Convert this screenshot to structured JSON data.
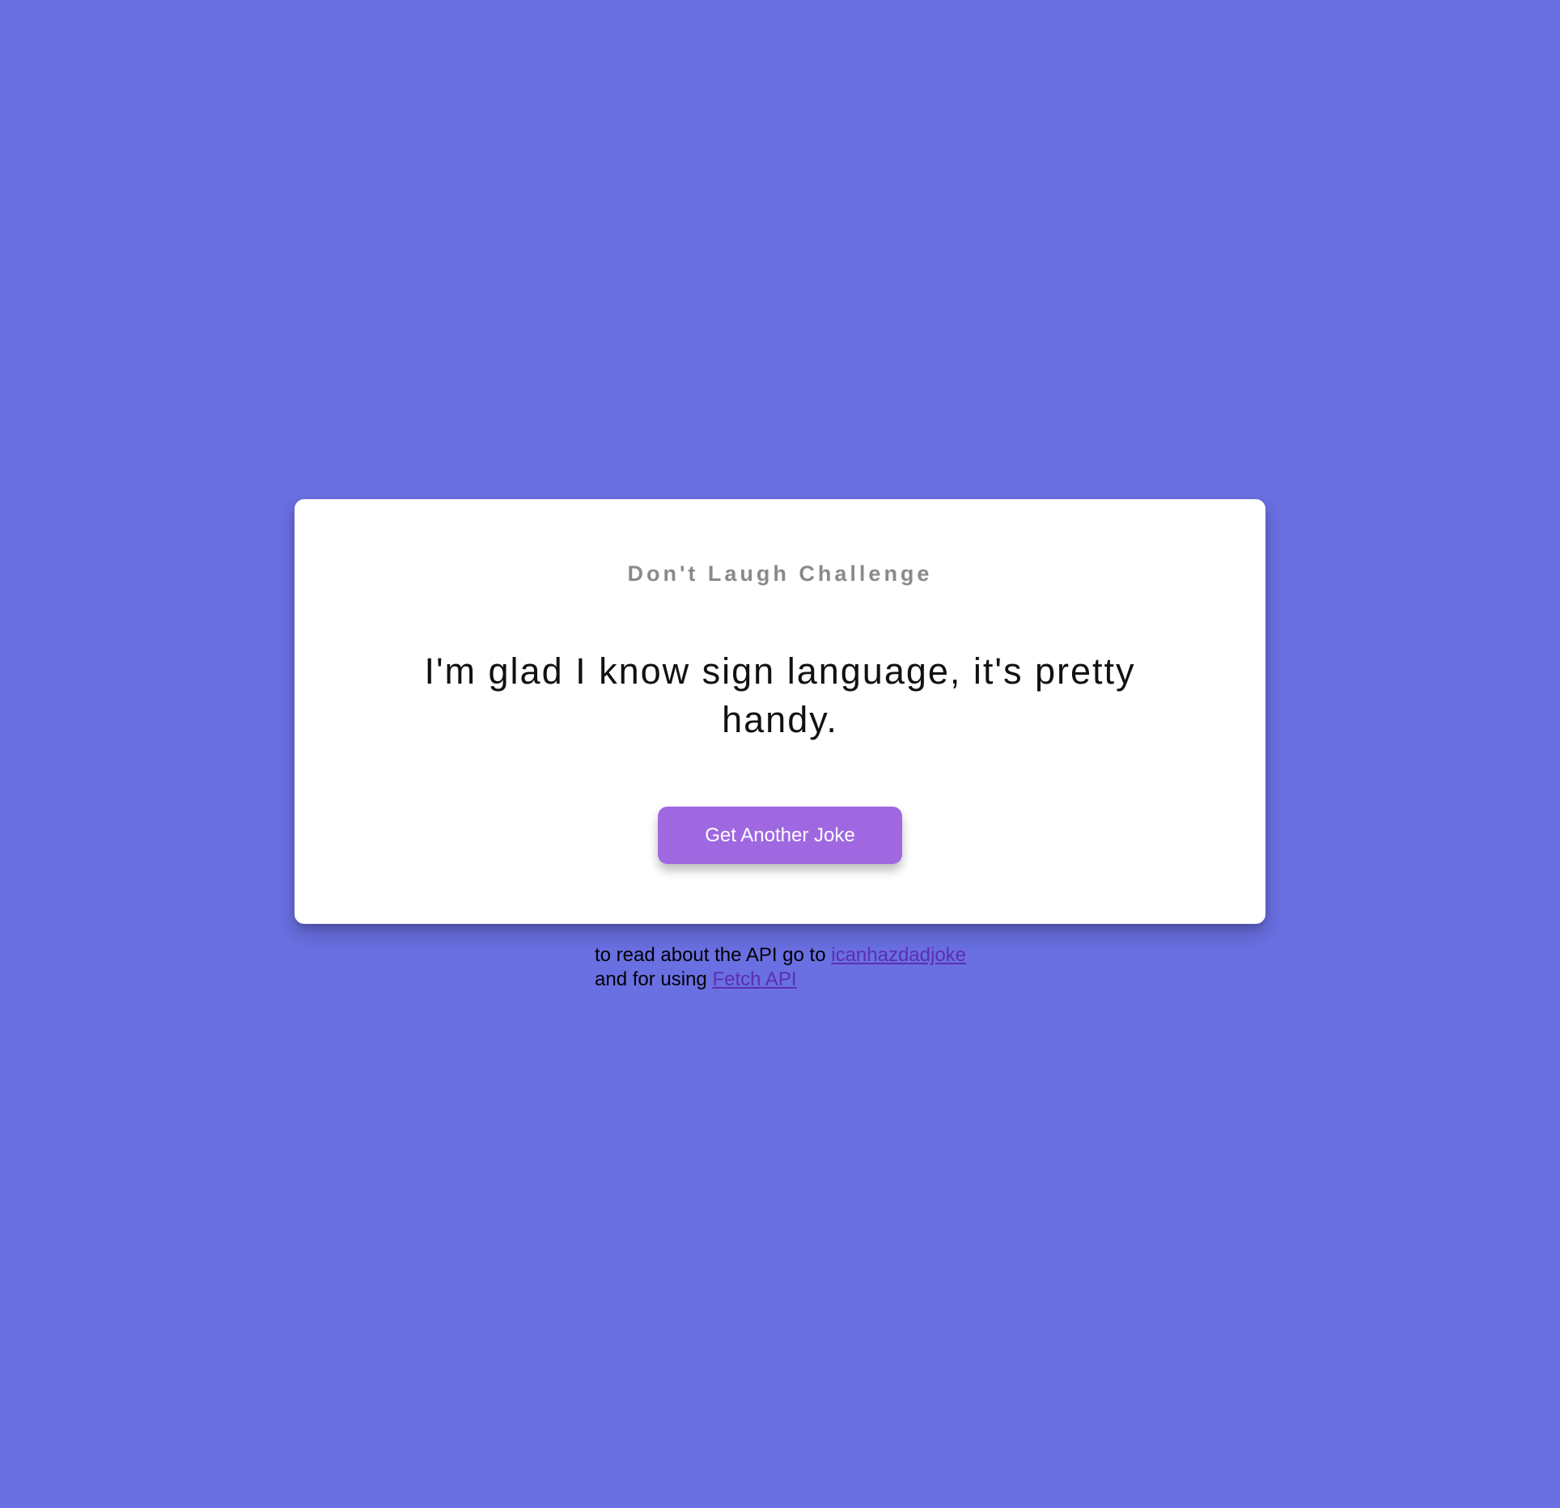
{
  "card": {
    "title": "Don't Laugh Challenge",
    "joke": "I'm glad I know sign language, it's pretty handy.",
    "button_label": "Get Another Joke"
  },
  "footer": {
    "line1_prefix": "to read about the API go to",
    "line1_link": "icanhazdadjoke",
    "line2_prefix": "and for using",
    "line2_link": "Fetch API"
  },
  "colors": {
    "background": "#6a6fe2",
    "card": "#ffffff",
    "button": "#9f68e0",
    "link": "#5b2fb0",
    "title": "#8a8a8a"
  }
}
